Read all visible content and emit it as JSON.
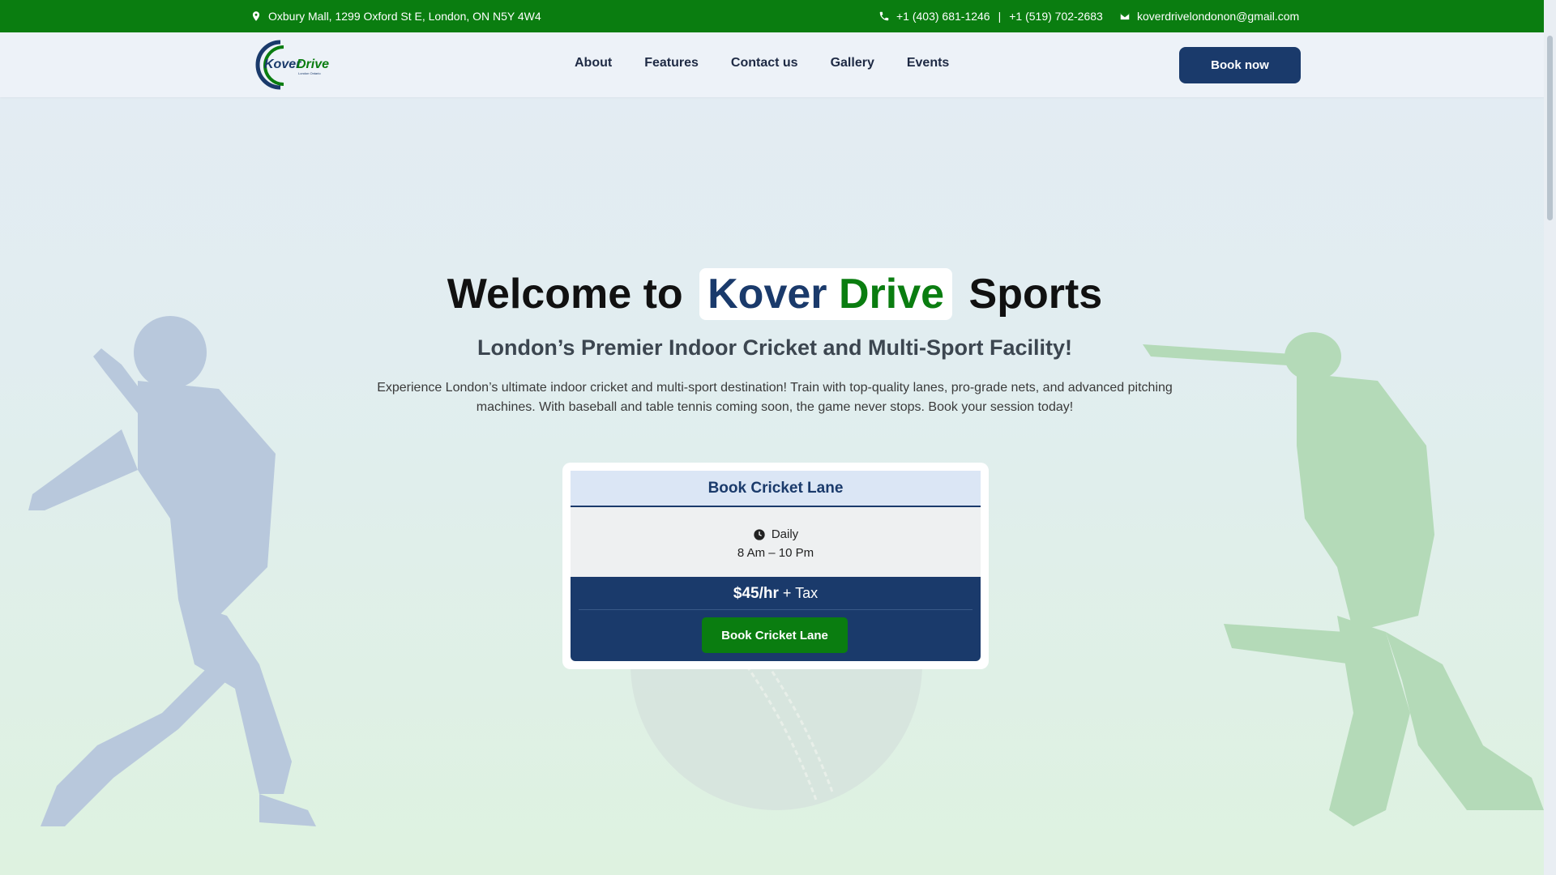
{
  "colors": {
    "primary_green": "#0a7d10",
    "navy": "#1a3a6b",
    "background_top": "#e4ecf4",
    "background_bottom": "#def2e0"
  },
  "topbar": {
    "address": "Oxbury Mall, 1299 Oxford St E, London, ON N5Y 4W4",
    "phone_1": "+1 (403) 681-1246",
    "separator": "|",
    "phone_2": "+1 (519) 702-2683",
    "email": "koverdrivelondonon@gmail.com",
    "icons": {
      "address": "location-pin-icon",
      "phone": "phone-icon",
      "email": "envelope-icon"
    }
  },
  "header": {
    "logo": {
      "word_1": "Kover",
      "word_2": "Drive",
      "tagline": "London Ontario"
    },
    "nav": [
      {
        "label": "About"
      },
      {
        "label": "Features"
      },
      {
        "label": "Contact us"
      },
      {
        "label": "Gallery"
      },
      {
        "label": "Events"
      }
    ],
    "book_now_label": "Book now"
  },
  "hero": {
    "title_prefix": "Welcome to",
    "brand_word_1": "Kover",
    "brand_word_2": "Drive",
    "title_suffix": "Sports",
    "subtitle": "London’s Premier Indoor Cricket and Multi-Sport Facility!",
    "description": "Experience London’s ultimate indoor cricket and multi-sport destination! Train with top-quality lanes, pro-grade nets, and advanced pitching machines. With baseball and table tennis coming soon, the game never stops. Book your session today!"
  },
  "booking_card": {
    "title": "Book Cricket Lane",
    "schedule_label": "Daily",
    "hours": "8 Am – 10 Pm",
    "price": "$45/hr",
    "price_suffix": "+ Tax",
    "button_label": "Book Cricket Lane",
    "icon": "clock-icon"
  }
}
